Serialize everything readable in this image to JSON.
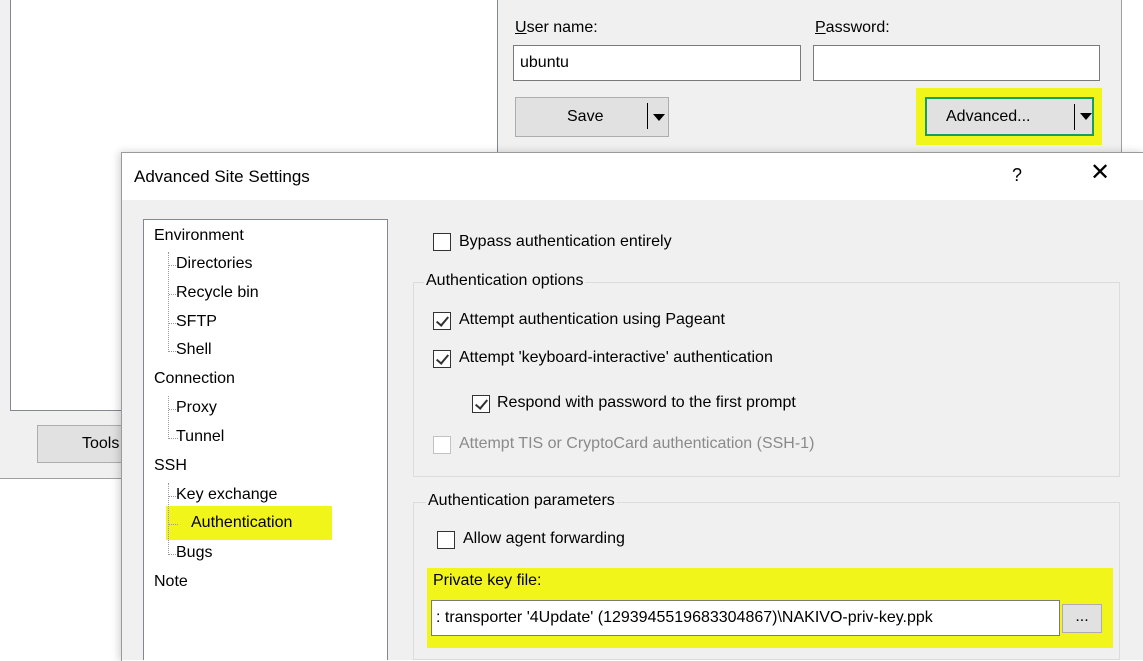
{
  "background_window": {
    "user_name_label": "User name:",
    "user_name_value": "ubuntu",
    "password_label": "Password:",
    "password_value": "",
    "save_label": "Save",
    "advanced_label": "Advanced...",
    "tools_label": "Tools"
  },
  "dialog": {
    "title": "Advanced Site Settings",
    "help_label": "?",
    "close_label": "✕"
  },
  "tree": {
    "items": [
      {
        "label": "Environment",
        "level": 0
      },
      {
        "label": "Directories",
        "level": 1
      },
      {
        "label": "Recycle bin",
        "level": 1
      },
      {
        "label": "SFTP",
        "level": 1
      },
      {
        "label": "Shell",
        "level": 1
      },
      {
        "label": "Connection",
        "level": 0
      },
      {
        "label": "Proxy",
        "level": 1
      },
      {
        "label": "Tunnel",
        "level": 1
      },
      {
        "label": "SSH",
        "level": 0
      },
      {
        "label": "Key exchange",
        "level": 1
      },
      {
        "label": "Authentication",
        "level": 1,
        "selected": true
      },
      {
        "label": "Bugs",
        "level": 1
      },
      {
        "label": "Note",
        "level": 0
      }
    ]
  },
  "auth": {
    "bypass_label": "Bypass authentication entirely",
    "bypass_checked": false,
    "options_title": "Authentication options",
    "pageant_label": "Attempt authentication using Pageant",
    "pageant_checked": true,
    "kbd_label": "Attempt 'keyboard-interactive' authentication",
    "kbd_checked": true,
    "respond_label": "Respond with password to the first prompt",
    "respond_checked": true,
    "tis_label": "Attempt TIS or CryptoCard authentication (SSH-1)",
    "tis_checked": false,
    "params_title": "Authentication parameters",
    "agent_label": "Allow agent forwarding",
    "agent_checked": false,
    "key_file_label": "Private key file:",
    "key_file_value": ": transporter '4Update' (1293945519683304867)\\NAKIVO-priv-key.ppk",
    "browse_label": "..."
  },
  "colors": {
    "highlight": "#f2f51a",
    "focus_border": "#16a05a",
    "window_bg": "#f0f0f0"
  }
}
